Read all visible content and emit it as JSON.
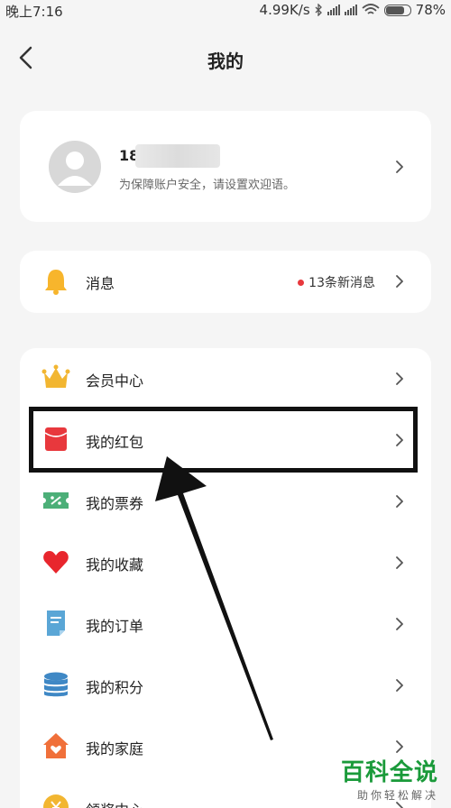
{
  "statusbar": {
    "time": "晚上7:16",
    "speed": "4.99K/s",
    "battery": "78%",
    "battery_level": 0.78
  },
  "header": {
    "title": "我的"
  },
  "profile": {
    "phone_prefix": "18",
    "tip": "为保障账户安全，请设置欢迎语。"
  },
  "messages": {
    "label": "消息",
    "badge": "13条新消息",
    "badge_color": "#e8383d"
  },
  "menu": [
    {
      "label": "会员中心",
      "icon": "crown-icon"
    },
    {
      "label": "我的红包",
      "icon": "red-envelope-icon"
    },
    {
      "label": "我的票券",
      "icon": "ticket-icon"
    },
    {
      "label": "我的收藏",
      "icon": "heart-icon"
    },
    {
      "label": "我的订单",
      "icon": "order-document-icon"
    },
    {
      "label": "我的积分",
      "icon": "points-coin-stack-icon"
    },
    {
      "label": "我的家庭",
      "icon": "family-home-icon"
    },
    {
      "label": "领奖中心",
      "icon": "prize-coin-icon"
    }
  ],
  "watermark": {
    "title": "百科全说",
    "subtitle": "助你轻松解决",
    "color": "#1a9a3a"
  }
}
